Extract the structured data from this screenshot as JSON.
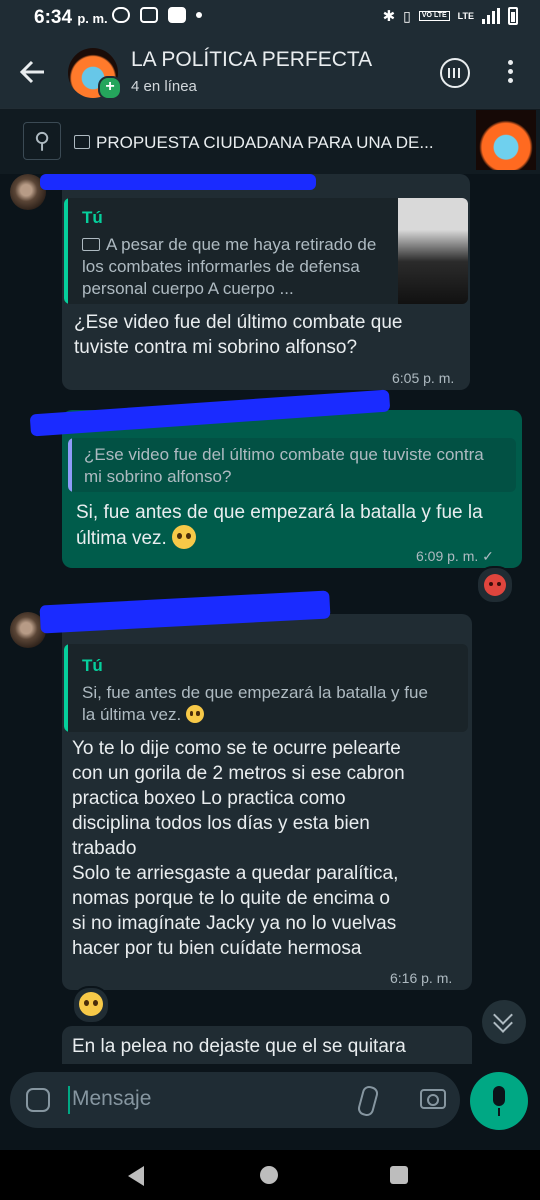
{
  "status_bar": {
    "time": "6:34",
    "ampm": "p. m.",
    "volte": "VO LTE",
    "lte": "LTE"
  },
  "header": {
    "title": "LA POLÍTICA PERFECTA",
    "subtitle": "4 en línea"
  },
  "pinned": {
    "text": "PROPUESTA CIUDADANA PARA UNA DE..."
  },
  "messages": [
    {
      "quote_name": "Tú",
      "quote_text": "A pesar de que me haya retirado de los combates informarles de defensa personal cuerpo A cuerpo ...",
      "text": "¿Ese video fue del último combate que tuviste contra mi sobrino alfonso?",
      "time": "6:05 p. m."
    },
    {
      "quote_text": "¿Ese video fue del último combate que tuviste contra mi sobrino alfonso?",
      "text": "Si, fue antes de que empezará  la batalla y fue la última vez.",
      "time": "6:09 p. m.",
      "check": "✓"
    },
    {
      "quote_name": "Tú",
      "quote_text": "Si, fue antes de que empezará  la batalla y fue la última vez.",
      "text_lines": [
        "Yo te lo dije como se te ocurre pelearte",
        "con un gorila de 2 metros si ese cabron",
        "practica boxeo Lo practica como",
        "disciplina todos los días y  esta bien",
        "trabado",
        "Solo te arriesgaste a quedar paralítica,",
        "nomas porque te lo quite de encima o",
        "si no imagínate Jacky ya no lo vuelvas",
        "hacer por tu bien cuídate hermosa"
      ],
      "time": "6:16 p. m."
    },
    {
      "text": "En la pelea no dejaste que el se quitara"
    }
  ],
  "input": {
    "placeholder": "Mensaje"
  },
  "icons": {
    "back": "arrow-left-icon",
    "voice_chat": "voice-chat-icon",
    "menu": "more-vert-icon",
    "pin": "pin-icon",
    "sticker": "sticker-icon",
    "attach": "paperclip-icon",
    "camera": "camera-icon",
    "mic": "mic-icon"
  },
  "colors": {
    "accent": "#00a884",
    "outgoing_bubble": "#005c4b",
    "incoming_bubble": "#202c33",
    "quote_name": "#06cf9c"
  }
}
